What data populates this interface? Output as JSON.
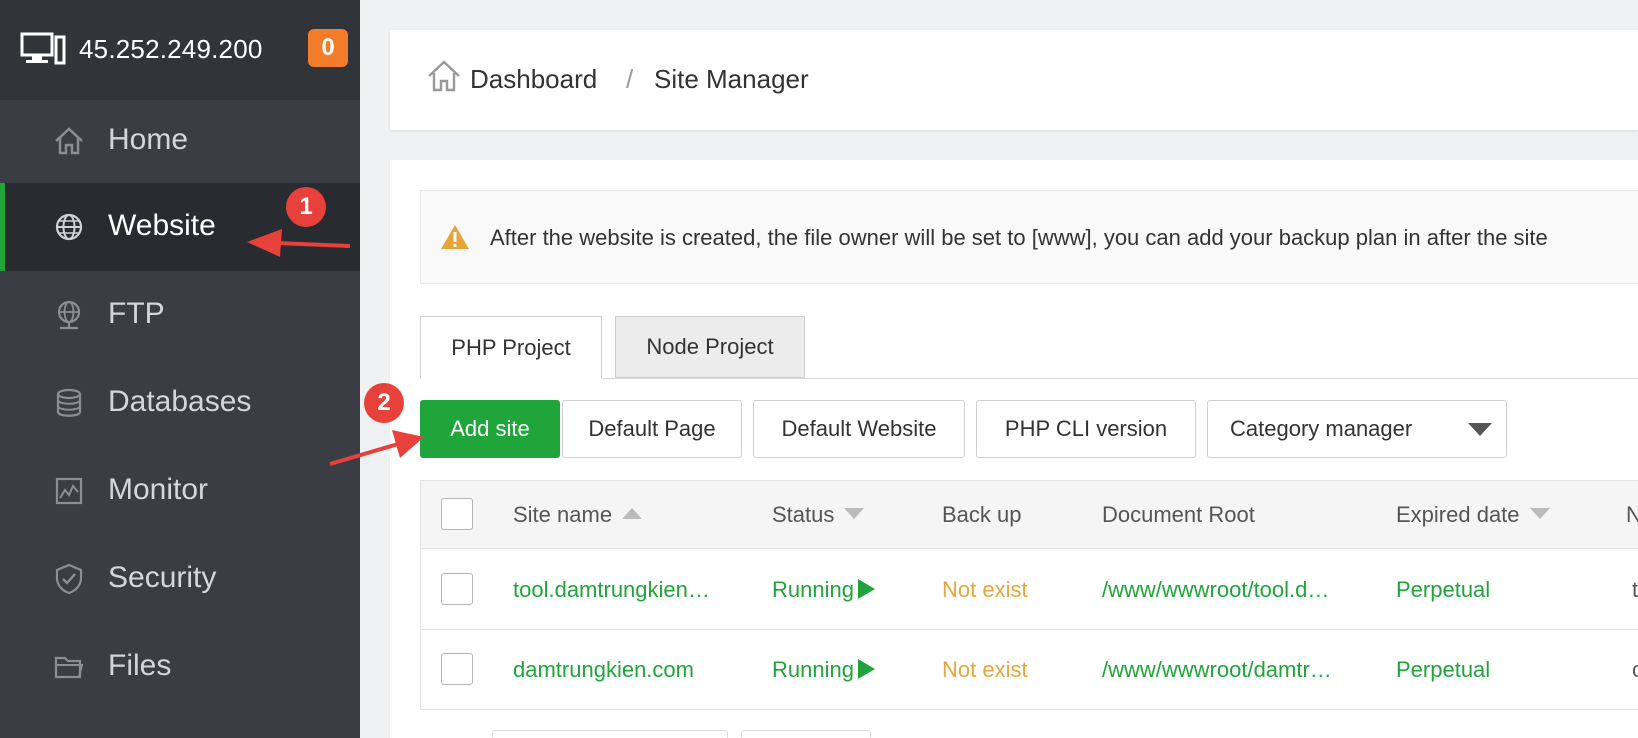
{
  "sidebar": {
    "server_ip": "45.252.249.200",
    "notification_count": "0",
    "items": [
      {
        "label": "Home",
        "icon": "home-icon"
      },
      {
        "label": "Website",
        "icon": "globe-icon",
        "active": true
      },
      {
        "label": "FTP",
        "icon": "ftp-globe-icon"
      },
      {
        "label": "Databases",
        "icon": "database-icon"
      },
      {
        "label": "Monitor",
        "icon": "monitor-icon"
      },
      {
        "label": "Security",
        "icon": "shield-icon"
      },
      {
        "label": "Files",
        "icon": "folder-icon"
      }
    ]
  },
  "breadcrumb": {
    "home": "Dashboard",
    "separator": "/",
    "current": "Site Manager"
  },
  "alert": {
    "text": "After the website is created, the file owner will be set to [www], you can add your backup plan in after the site"
  },
  "tabs": [
    {
      "label": "PHP Project",
      "active": true
    },
    {
      "label": "Node Project",
      "active": false
    }
  ],
  "toolbar": {
    "add_site": "Add site",
    "default_page": "Default Page",
    "default_website": "Default Website",
    "php_cli": "PHP CLI version",
    "category_manager": "Category manager"
  },
  "table": {
    "columns": [
      "Site name",
      "Status",
      "Back up",
      "Document Root",
      "Expired date",
      "N"
    ],
    "rows": [
      {
        "site": "tool.damtrungkien…",
        "status": "Running",
        "backup": "Not exist",
        "root": "/www/wwwroot/tool.d…",
        "expired": "Perpetual",
        "extra": "t"
      },
      {
        "site": "damtrungkien.com",
        "status": "Running",
        "backup": "Not exist",
        "root": "/www/wwwroot/damtr…",
        "expired": "Perpetual",
        "extra": "c"
      }
    ]
  },
  "annotations": {
    "step1": "1",
    "step2": "2"
  },
  "colors": {
    "brand_green": "#20a53a",
    "sidebar_bg": "#3a3e44",
    "badge_orange": "#f37c2a",
    "warning_orange": "#e8a33a",
    "annotation_red": "#e8413b"
  }
}
